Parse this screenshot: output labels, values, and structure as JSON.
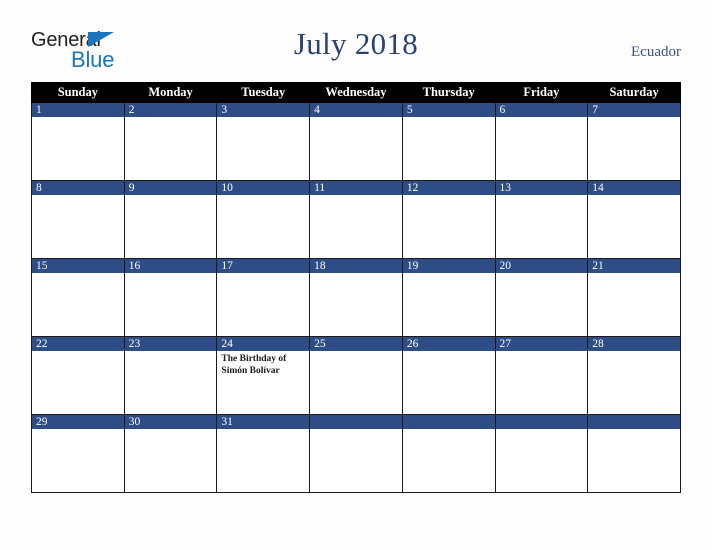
{
  "brand": {
    "line1": "General",
    "line2": "Blue",
    "triangle_color": "#1b75bc",
    "line1_color": "#231f20",
    "line2_color": "#1b75bc"
  },
  "header": {
    "title": "July 2018",
    "country": "Ecuador",
    "title_color": "#2c4272",
    "country_color": "#3c5280"
  },
  "calendar": {
    "weekday_headers": [
      "Sunday",
      "Monday",
      "Tuesday",
      "Wednesday",
      "Thursday",
      "Friday",
      "Saturday"
    ],
    "header_bg": "#000000",
    "header_text_color": "#ffffff",
    "daybar_bg": "#2e4d87",
    "daybar_text_color": "#ffffff",
    "cell_bg": "#ffffff",
    "grid_border_color": "#1a1a1a",
    "weeks": [
      [
        {
          "day": "1",
          "events": []
        },
        {
          "day": "2",
          "events": []
        },
        {
          "day": "3",
          "events": []
        },
        {
          "day": "4",
          "events": []
        },
        {
          "day": "5",
          "events": []
        },
        {
          "day": "6",
          "events": []
        },
        {
          "day": "7",
          "events": []
        }
      ],
      [
        {
          "day": "8",
          "events": []
        },
        {
          "day": "9",
          "events": []
        },
        {
          "day": "10",
          "events": []
        },
        {
          "day": "11",
          "events": []
        },
        {
          "day": "12",
          "events": []
        },
        {
          "day": "13",
          "events": []
        },
        {
          "day": "14",
          "events": []
        }
      ],
      [
        {
          "day": "15",
          "events": []
        },
        {
          "day": "16",
          "events": []
        },
        {
          "day": "17",
          "events": []
        },
        {
          "day": "18",
          "events": []
        },
        {
          "day": "19",
          "events": []
        },
        {
          "day": "20",
          "events": []
        },
        {
          "day": "21",
          "events": []
        }
      ],
      [
        {
          "day": "22",
          "events": []
        },
        {
          "day": "23",
          "events": []
        },
        {
          "day": "24",
          "events": [
            "The Birthday of Simón Bolívar"
          ]
        },
        {
          "day": "25",
          "events": []
        },
        {
          "day": "26",
          "events": []
        },
        {
          "day": "27",
          "events": []
        },
        {
          "day": "28",
          "events": []
        }
      ],
      [
        {
          "day": "29",
          "events": []
        },
        {
          "day": "30",
          "events": []
        },
        {
          "day": "31",
          "events": []
        },
        {
          "day": "",
          "events": []
        },
        {
          "day": "",
          "events": []
        },
        {
          "day": "",
          "events": []
        },
        {
          "day": "",
          "events": []
        }
      ]
    ]
  }
}
